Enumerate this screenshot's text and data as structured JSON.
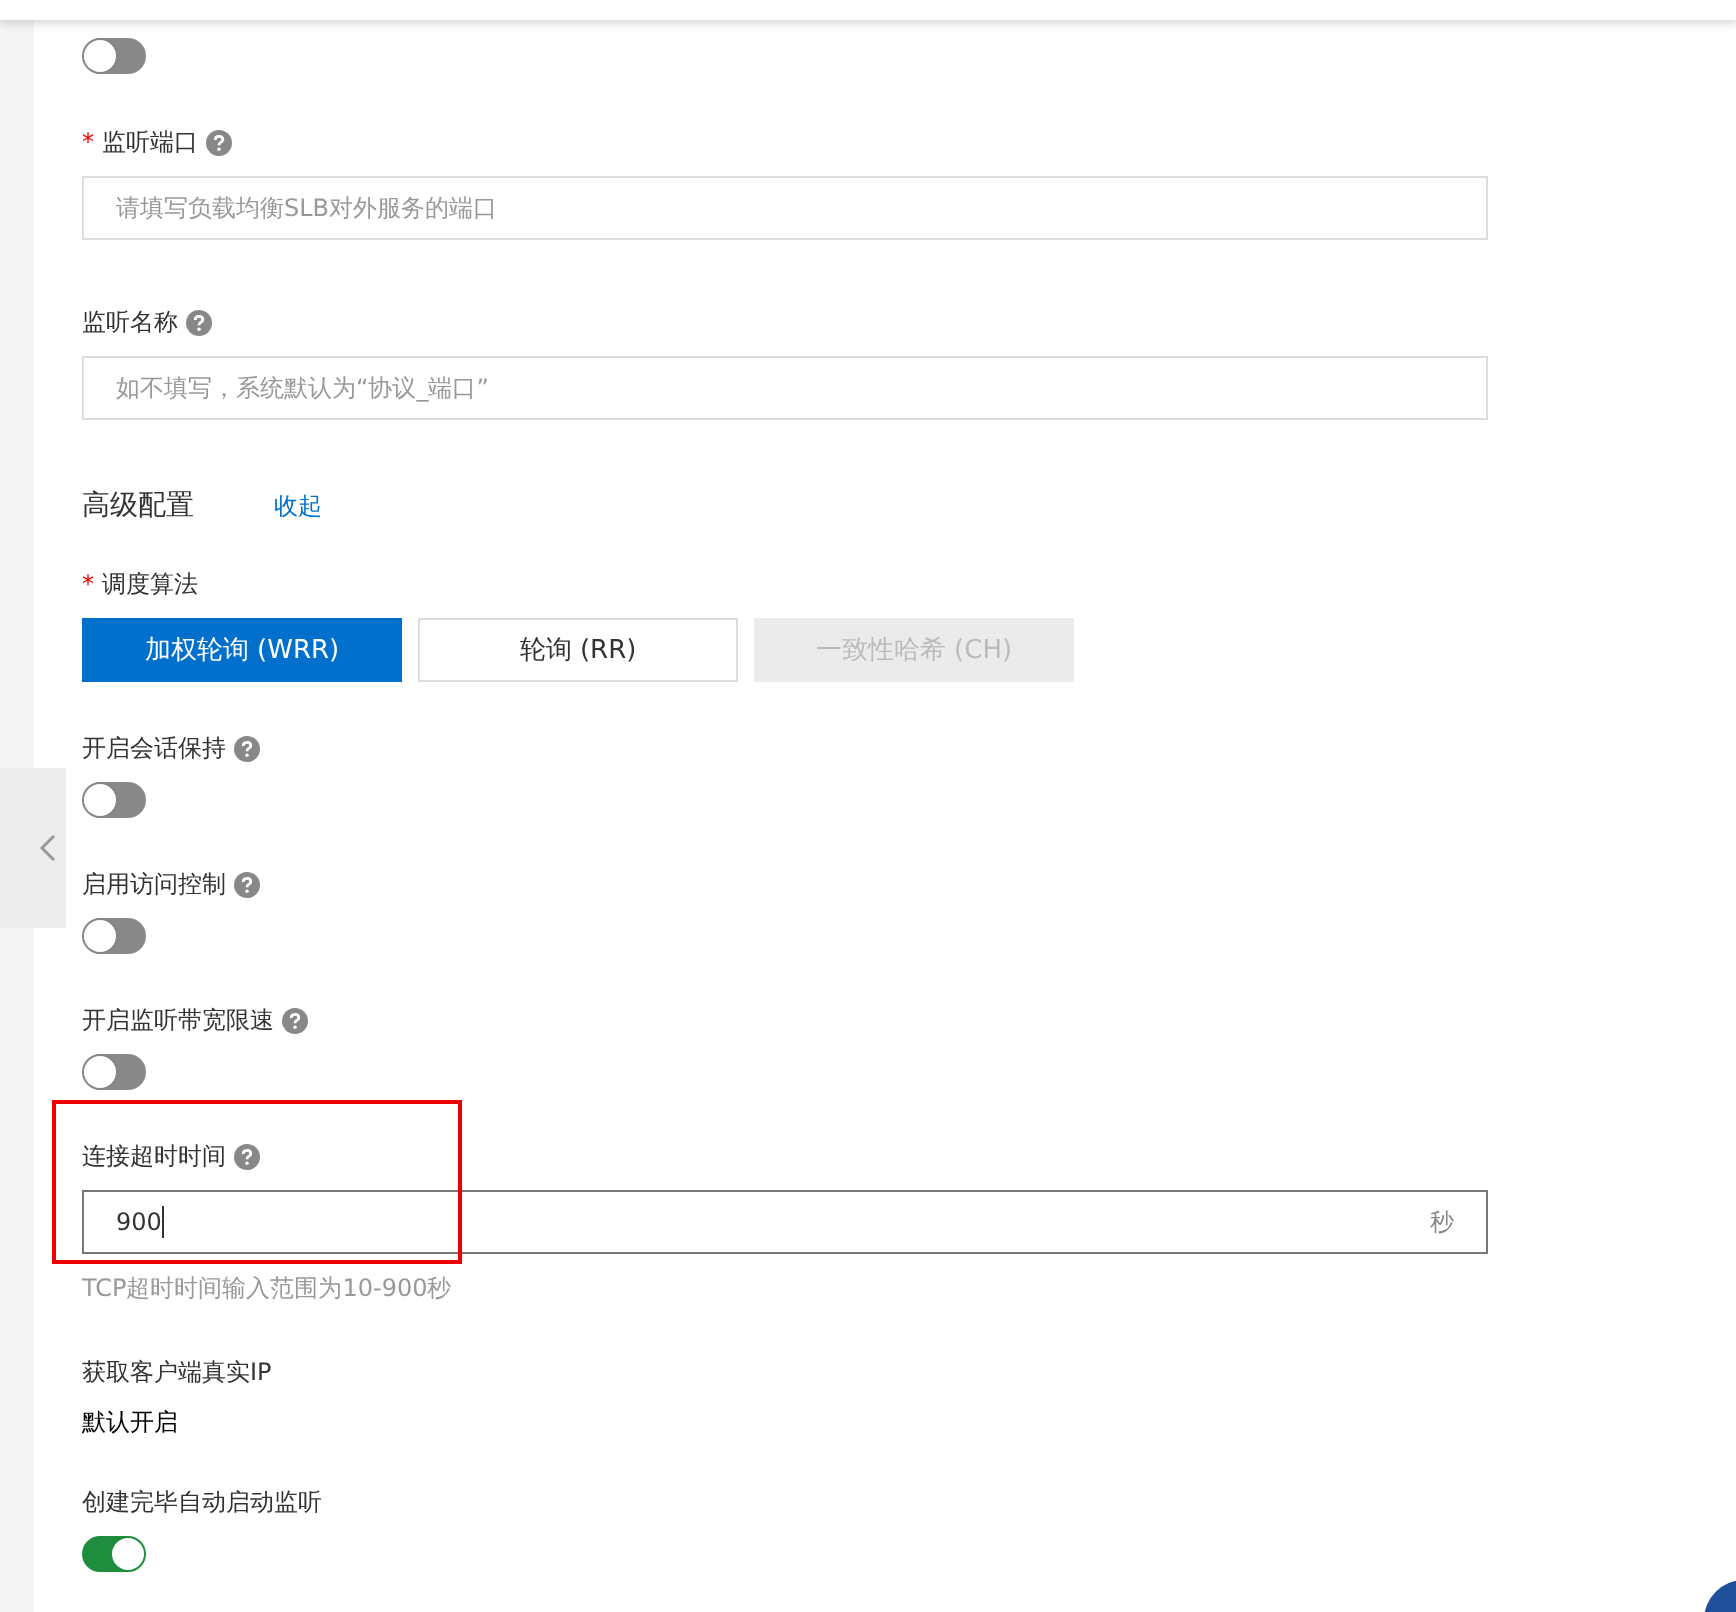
{
  "required_mark": "*",
  "fields": [
    {
      "kind": "toggle",
      "on": false
    },
    {
      "kind": "input",
      "required": true,
      "label": "监听端口",
      "help": true,
      "placeholder": "请填写负载均衡SLB对外服务的端口"
    },
    {
      "kind": "input",
      "required": false,
      "label": "监听名称",
      "help": true,
      "placeholder": "如不填写，系统默认为“协议_端口”"
    },
    {
      "kind": "section",
      "label": "高级配置",
      "link": "收起"
    },
    {
      "kind": "segmented",
      "required": true,
      "label": "调度算法",
      "options": [
        {
          "label": "加权轮询 (WRR)",
          "selected": true,
          "disabled": false
        },
        {
          "label": "轮询 (RR)",
          "selected": false,
          "disabled": false
        },
        {
          "label": "一致性哈希 (CH)",
          "selected": false,
          "disabled": true
        }
      ]
    },
    {
      "kind": "toggle",
      "label": "开启会话保持",
      "help": true,
      "on": false
    },
    {
      "kind": "toggle",
      "label": "启用访问控制",
      "help": true,
      "on": false
    },
    {
      "kind": "toggle",
      "label": "开启监听带宽限速",
      "help": true,
      "on": false
    },
    {
      "kind": "number",
      "label": "连接超时时间",
      "help": true,
      "value": "900",
      "unit": "秒",
      "hint": "TCP超时时间输入范围为10-900秒",
      "highlighted": true
    },
    {
      "kind": "text",
      "label": "获取客户端真实IP",
      "value": "默认开启"
    },
    {
      "kind": "toggle",
      "label": "创建完毕自动启动监听",
      "help": false,
      "on": true
    }
  ]
}
